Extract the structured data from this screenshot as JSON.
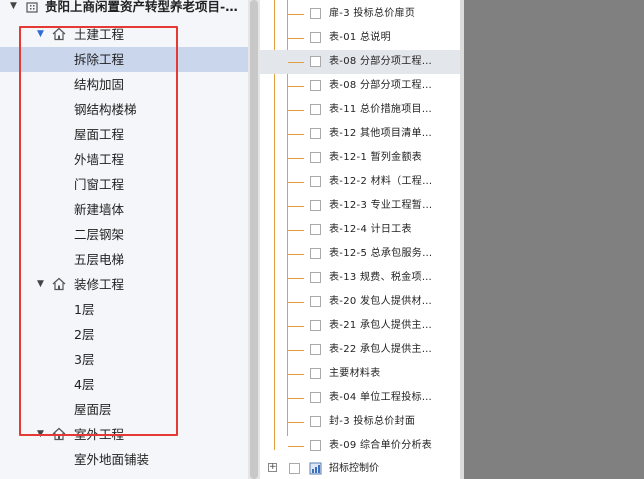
{
  "tree": {
    "project_title": "贵阳上商闲置资产转型养老项目-…",
    "groups": [
      {
        "label": "土建工程",
        "children": [
          "拆除工程",
          "结构加固",
          "钢结构楼梯",
          "屋面工程",
          "外墙工程",
          "门窗工程",
          "新建墙体",
          "二层钢架",
          "五层电梯"
        ]
      },
      {
        "label": "装修工程",
        "children": [
          "1层",
          "2层",
          "3层",
          "4层",
          "屋面层"
        ]
      },
      {
        "label": "室外工程",
        "children": [
          "室外地面铺装"
        ]
      }
    ],
    "selected_item": "拆除工程"
  },
  "report_list": {
    "items": [
      "扉-3 投标总价扉页",
      "表-01 总说明",
      "表-08 分部分项工程…",
      "表-08 分部分项工程…",
      "表-11 总价措施项目…",
      "表-12 其他项目清单…",
      "表-12-1 暂列金额表",
      "表-12-2 材料（工程…",
      "表-12-3 专业工程暂…",
      "表-12-4 计日工表",
      "表-12-5 总承包服务…",
      "表-13 规费、税金项…",
      "表-20 发包人提供材…",
      "表-21 承包人提供主…",
      "表-22 承包人提供主…",
      "主要材料表",
      "表-04 单位工程投标…",
      "封-3 投标总价封面",
      "表-09 综合单价分析表"
    ],
    "highlighted_index": 2,
    "bottom_node_label": "招标控制价"
  },
  "colors": {
    "selection": "#c9d6ec",
    "annotation_box": "#e53935",
    "tree_connector": "#e0a040",
    "right_panel": "#808080"
  }
}
